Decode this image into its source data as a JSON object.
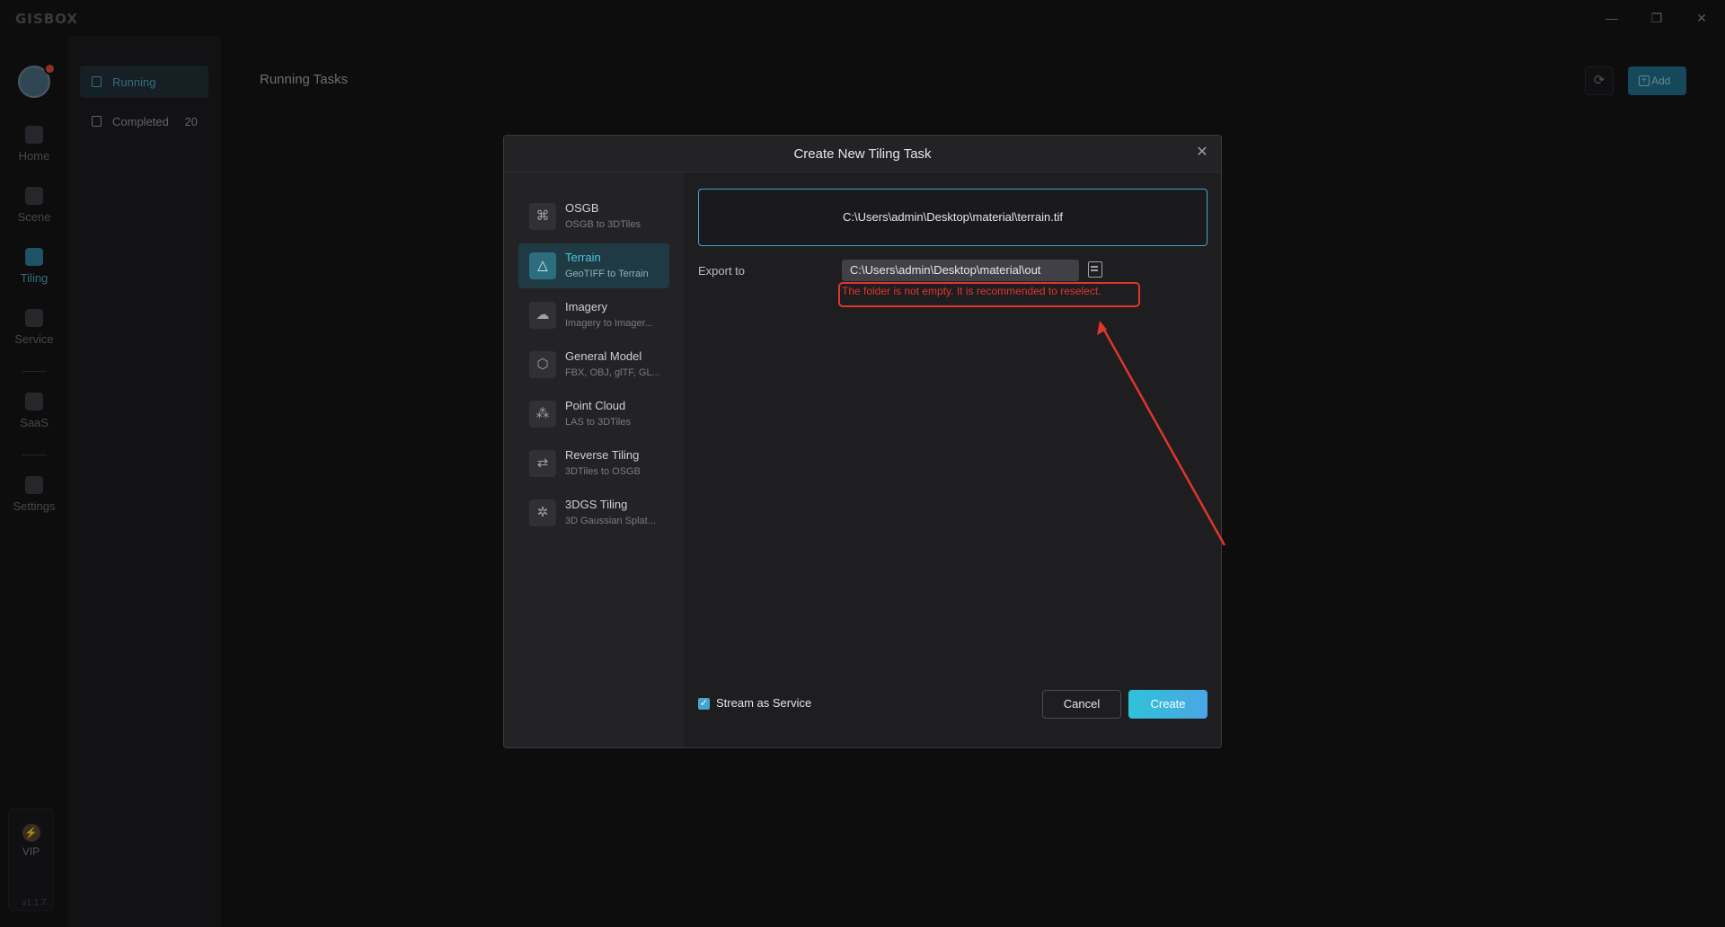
{
  "app": {
    "logo": "GISBOX",
    "version": "v1.1.7"
  },
  "window_controls": {
    "minimize": "—",
    "restore": "❐",
    "close": "✕"
  },
  "rail": {
    "items": [
      {
        "label": "Home",
        "icon": "home-icon"
      },
      {
        "label": "Scene",
        "icon": "scene-icon"
      },
      {
        "label": "Tiling",
        "icon": "tiling-icon"
      },
      {
        "label": "Service",
        "icon": "service-icon"
      },
      {
        "label": "SaaS",
        "icon": "saas-icon"
      },
      {
        "label": "Settings",
        "icon": "settings-icon"
      }
    ],
    "active": "Tiling",
    "vip_label": "VIP"
  },
  "subnav": {
    "items": [
      {
        "label": "Running",
        "count": ""
      },
      {
        "label": "Completed",
        "count": "20"
      }
    ]
  },
  "main": {
    "title": "Running Tasks",
    "add_label": "Add"
  },
  "dialog": {
    "title": "Create New Tiling Task",
    "types": [
      {
        "name": "OSGB",
        "desc": "OSGB to 3DTiles",
        "icon": "osgb-icon"
      },
      {
        "name": "Terrain",
        "desc": "GeoTIFF to Terrain",
        "icon": "terrain-icon"
      },
      {
        "name": "Imagery",
        "desc": "Imagery to Imager...",
        "icon": "imagery-icon"
      },
      {
        "name": "General Model",
        "desc": "FBX, OBJ, glTF, GL...",
        "icon": "model-cube-icon"
      },
      {
        "name": "Point Cloud",
        "desc": "LAS to 3DTiles",
        "icon": "point-cloud-icon"
      },
      {
        "name": "Reverse Tiling",
        "desc": "3DTiles to OSGB",
        "icon": "reverse-tiling-icon"
      },
      {
        "name": "3DGS Tiling",
        "desc": "3D Gaussian Splat...",
        "icon": "gaussian-splat-icon"
      }
    ],
    "active_type": "Terrain",
    "source_path": "C:\\Users\\admin\\Desktop\\material\\terrain.tif",
    "export_label": "Export to",
    "export_path": "C:\\Users\\admin\\Desktop\\material\\out",
    "error_message": "The folder is not empty. It is recommended to reselect.",
    "stream_label": "Stream as Service",
    "stream_checked": true,
    "cancel_label": "Cancel",
    "create_label": "Create"
  },
  "colors": {
    "accent": "#3fa7c9",
    "error": "#e0352b",
    "annotation": "#e0352b"
  }
}
